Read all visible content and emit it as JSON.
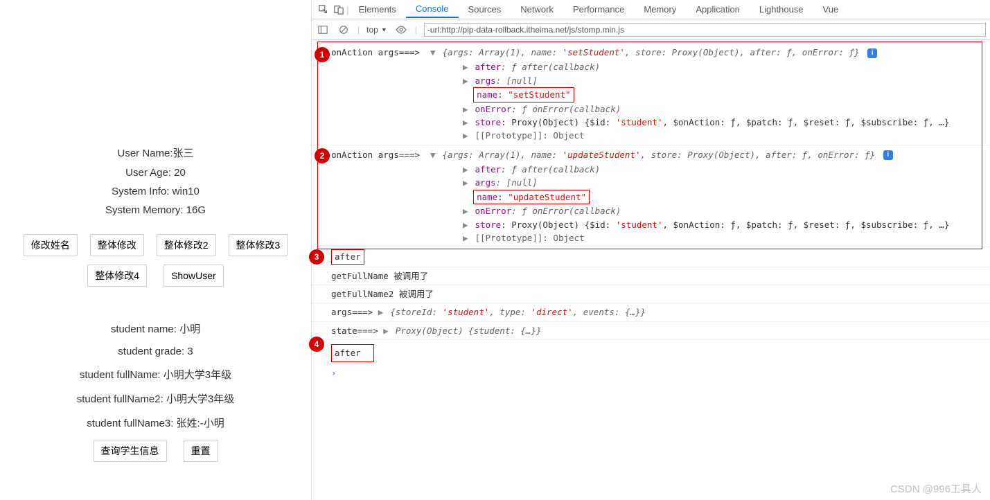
{
  "left": {
    "user_name_line": "User Name:张三",
    "user_age_line": "User Age: 20",
    "system_info_line": "System Info: win10",
    "system_memory_line": "System Memory: 16G",
    "buttons_row1": [
      "修改姓名",
      "整体修改",
      "整体修改2",
      "整体修改3"
    ],
    "buttons_row2": [
      "整体修改4",
      "ShowUser"
    ],
    "student_name_line": "student name: 小明",
    "student_grade_line": "student grade: 3",
    "student_fullname_line": "student fullName: 小明大学3年级",
    "student_fullname2_line": "student fullName2: 小明大学3年级",
    "student_fullname3_line": "student fullName3: 张姓:-小明",
    "buttons_row3": [
      "查询学生信息",
      "重置"
    ]
  },
  "devtools": {
    "tabs": [
      "Elements",
      "Console",
      "Sources",
      "Network",
      "Performance",
      "Memory",
      "Application",
      "Lighthouse",
      "Vue"
    ],
    "active_tab": "Console",
    "top_label": "top",
    "filter_value": "-url:http://pip-data-rollback.itheima.net/js/stomp.min.js"
  },
  "badges": {
    "b1": "1",
    "b2": "2",
    "b3": "3",
    "b4": "4"
  },
  "log1": {
    "prefix": "onAction args===>",
    "header_before_name": "{args: Array(1), name: ",
    "header_name": "'setStudent'",
    "header_after_name": ", store: Proxy(Object), after: ƒ, onError: ƒ}",
    "after_key": "after",
    "after_val": ": ƒ after(callback)",
    "args_key": "args",
    "args_val": ": [null]",
    "name_key": "name",
    "name_sep": ": ",
    "name_val": "\"setStudent\"",
    "onerror_key": "onError",
    "onerror_val": ": ƒ onError(callback)",
    "store_key": "store",
    "store_mid": ": Proxy(Object) {$id: ",
    "store_id": "'student'",
    "store_tail": ", $onAction: ƒ, $patch: ƒ, $reset: ƒ, $subscribe: ƒ, …}",
    "proto": "[[Prototype]]: Object"
  },
  "log2": {
    "prefix": "onAction args===>",
    "header_before_name": "{args: Array(1), name: ",
    "header_name": "'updateStudent'",
    "header_after_name": ", store: Proxy(Object), after: ƒ, onError: ƒ}",
    "after_key": "after",
    "after_val": ": ƒ after(callback)",
    "args_key": "args",
    "args_val": ": [null]",
    "name_key": "name",
    "name_sep": ": ",
    "name_val": "\"updateStudent\"",
    "onerror_key": "onError",
    "onerror_val": ": ƒ onError(callback)",
    "store_key": "store",
    "store_mid": ": Proxy(Object) {$id: ",
    "store_id": "'student'",
    "store_tail": ", $onAction: ƒ, $patch: ƒ, $reset: ƒ, $subscribe: ƒ, …}",
    "proto": "[[Prototype]]: Object"
  },
  "after1": "after",
  "getfull1": "getFullName 被调用了",
  "getfull2": "getFullName2 被调用了",
  "args_line": {
    "prefix": "args===> ",
    "body_before": "{storeId: ",
    "store_id": "'student'",
    "body_mid": ", type: ",
    "type_val": "'direct'",
    "body_after": ", events: {…}}"
  },
  "state_line": {
    "prefix": "state===> ",
    "body": "Proxy(Object) {student: {…}}"
  },
  "after2": "after",
  "watermark": "CSDN @996工具人"
}
